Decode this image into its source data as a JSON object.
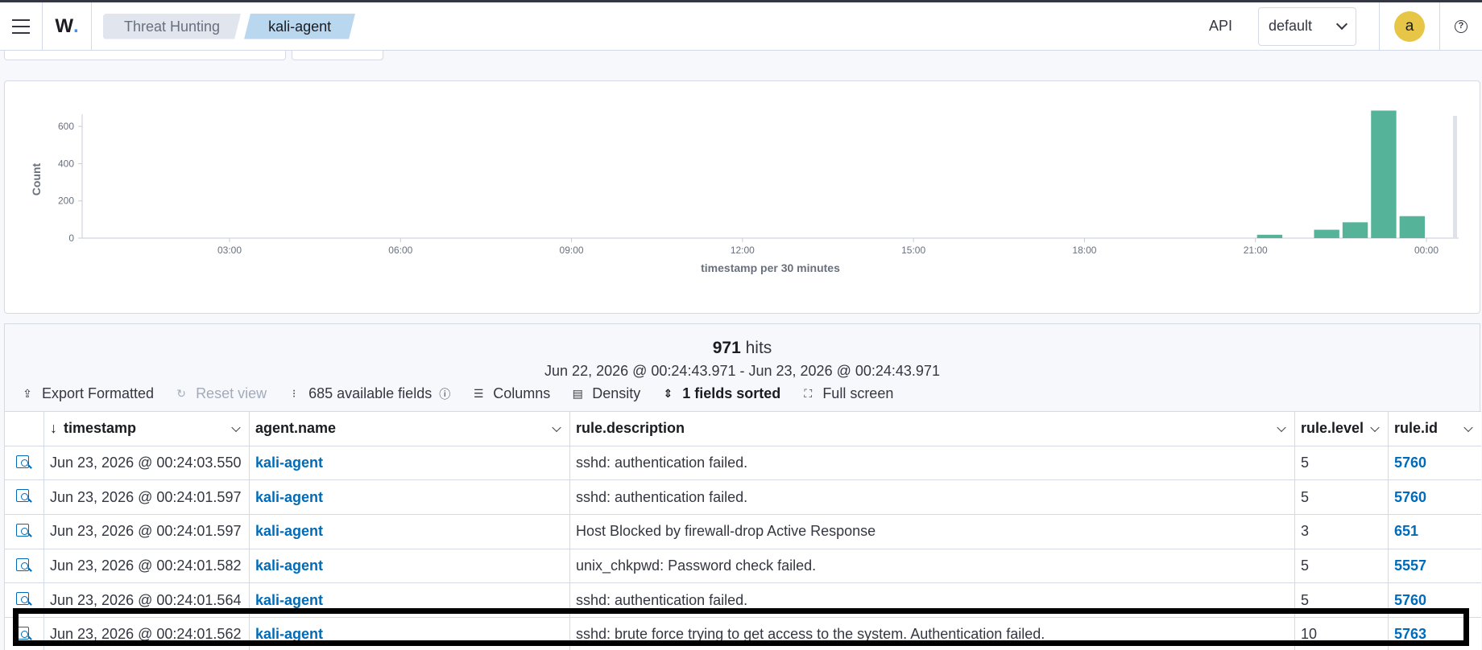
{
  "header": {
    "logo": "W",
    "breadcrumbs": [
      "Threat Hunting",
      "kali-agent"
    ],
    "api_label": "API",
    "tenant": "default",
    "avatar_initial": "a"
  },
  "chart_data": {
    "type": "bar",
    "xlabel": "timestamp per 30 minutes",
    "ylabel": "Count",
    "x_tick_labels": [
      "03:00",
      "06:00",
      "09:00",
      "12:00",
      "15:00",
      "18:00",
      "21:00",
      "00:00"
    ],
    "y_ticks": [
      0,
      200,
      400,
      600
    ],
    "ylim": [
      0,
      700
    ],
    "bar_color": "#54b399",
    "bars": [
      {
        "x": "21:30",
        "value": 18
      },
      {
        "x": "22:30",
        "value": 45
      },
      {
        "x": "23:00",
        "value": 85
      },
      {
        "x": "23:30",
        "value": 685
      },
      {
        "x": "00:00",
        "value": 118
      }
    ]
  },
  "hits": {
    "count": "971",
    "suffix": " hits",
    "range": "Jun 22, 2026 @ 00:24:43.971 - Jun 23, 2026 @ 00:24:43.971"
  },
  "toolbar": {
    "export": "Export Formatted",
    "reset": "Reset view",
    "fields": "685 available fields",
    "columns": "Columns",
    "density": "Density",
    "sorted": "1 fields sorted",
    "fullscreen": "Full screen"
  },
  "table": {
    "columns": [
      "timestamp",
      "agent.name",
      "rule.description",
      "rule.level",
      "rule.id"
    ],
    "rows": [
      {
        "timestamp": "Jun 23, 2026 @ 00:24:03.550",
        "agent": "kali-agent",
        "description": "sshd: authentication failed.",
        "level": "5",
        "id": "5760"
      },
      {
        "timestamp": "Jun 23, 2026 @ 00:24:01.597",
        "agent": "kali-agent",
        "description": "sshd: authentication failed.",
        "level": "5",
        "id": "5760"
      },
      {
        "timestamp": "Jun 23, 2026 @ 00:24:01.597",
        "agent": "kali-agent",
        "description": "Host Blocked by firewall-drop Active Response",
        "level": "3",
        "id": "651"
      },
      {
        "timestamp": "Jun 23, 2026 @ 00:24:01.582",
        "agent": "kali-agent",
        "description": "unix_chkpwd: Password check failed.",
        "level": "5",
        "id": "5557"
      },
      {
        "timestamp": "Jun 23, 2026 @ 00:24:01.564",
        "agent": "kali-agent",
        "description": "sshd: authentication failed.",
        "level": "5",
        "id": "5760"
      },
      {
        "timestamp": "Jun 23, 2026 @ 00:24:01.562",
        "agent": "kali-agent",
        "description": "sshd: brute force trying to get access to the system. Authentication failed.",
        "level": "10",
        "id": "5763"
      }
    ]
  }
}
